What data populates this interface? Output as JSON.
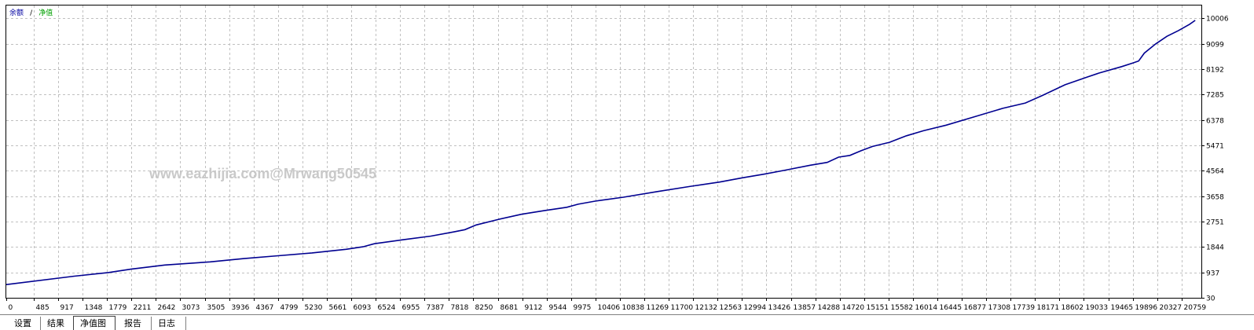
{
  "legend": {
    "balance_label": "余额",
    "separator": "/",
    "equity_label": "净值"
  },
  "watermark": "www.eazhijia.com@Mrwang50545",
  "tabs": [
    {
      "label": "设置"
    },
    {
      "label": "结果"
    },
    {
      "label": "净值图"
    },
    {
      "label": "报告"
    },
    {
      "label": "日志"
    }
  ],
  "active_tab": 2,
  "colors": {
    "line": "#000090",
    "grid": "#c0c0c0",
    "axis": "#000000",
    "tab_bg": "#d4d0c8"
  },
  "chart_data": {
    "type": "line",
    "grid": true,
    "x_ticks": [
      "0",
      "485",
      "917",
      "1348",
      "1779",
      "2211",
      "2642",
      "3073",
      "3505",
      "3936",
      "4367",
      "4799",
      "5230",
      "5661",
      "6093",
      "6524",
      "6955",
      "7387",
      "7818",
      "8250",
      "8681",
      "9112",
      "9544",
      "9975",
      "10406",
      "10838",
      "11269",
      "11700",
      "12132",
      "12563",
      "12994",
      "13426",
      "13857",
      "14288",
      "14720",
      "15151",
      "15582",
      "16014",
      "16445",
      "16877",
      "17308",
      "17739",
      "18171",
      "18602",
      "19033",
      "19465",
      "19896",
      "20327",
      "20759"
    ],
    "y_ticks": [
      "30",
      "937",
      "1844",
      "2751",
      "3658",
      "4564",
      "5471",
      "6378",
      "7285",
      "8192",
      "9099",
      "10006"
    ],
    "xlim": [
      0,
      21108
    ],
    "ylim": [
      30,
      10460
    ],
    "series": [
      {
        "x": [
          0,
          1200,
          1800,
          2200,
          2800,
          3600,
          4200,
          4800,
          5400,
          6000,
          6300,
          6500,
          7000,
          7500,
          7900,
          8100,
          8300,
          8700,
          9100,
          9500,
          9900,
          10100,
          10400,
          10900,
          11500,
          12100,
          12600,
          13000,
          13400,
          13800,
          14200,
          14500,
          14700,
          14900,
          15100,
          15300,
          15600,
          15900,
          16200,
          16600,
          17100,
          17600,
          18000,
          18300,
          18700,
          19100,
          19300,
          19700,
          19900,
          20000,
          20100,
          20300,
          20500,
          20700,
          20900,
          21000
        ],
        "y": [
          500,
          800,
          930,
          1050,
          1200,
          1310,
          1430,
          1530,
          1630,
          1760,
          1850,
          1960,
          2100,
          2230,
          2380,
          2460,
          2630,
          2830,
          3010,
          3140,
          3260,
          3370,
          3480,
          3620,
          3820,
          4010,
          4160,
          4310,
          4450,
          4600,
          4760,
          4860,
          5050,
          5110,
          5280,
          5430,
          5580,
          5810,
          5990,
          6190,
          6490,
          6790,
          6980,
          7250,
          7630,
          7910,
          8050,
          8280,
          8410,
          8480,
          8760,
          9090,
          9360,
          9560,
          9790,
          9930
        ]
      }
    ]
  }
}
